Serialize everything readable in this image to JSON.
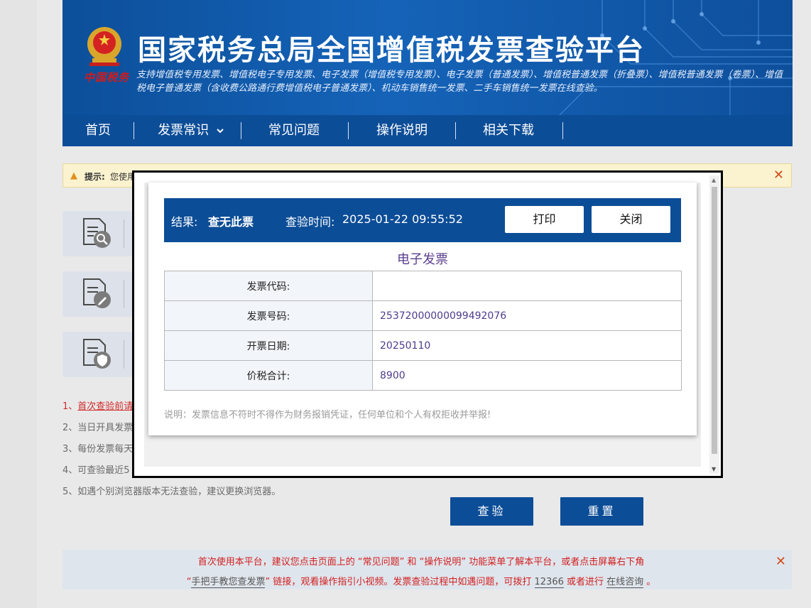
{
  "header": {
    "title": "国家税务总局全国增值税发票查验平台",
    "subtitle": "支持增值税专用发票、增值税电子专用发票、电子发票（增值税专用发票）、电子发票（普通发票）、增值税普通发票（折叠票）、增值税普通发票（卷票）、增值税电子普通发票（含收费公路通行费增值税电子普通发票）、机动车销售统一发票、二手车销售统一发票在线查验。",
    "emblem_text": "中国税务"
  },
  "nav": {
    "items": [
      {
        "label": "首页"
      },
      {
        "label": "发票常识"
      },
      {
        "label": "常见问题"
      },
      {
        "label": "操作说明"
      },
      {
        "label": "相关下载"
      }
    ]
  },
  "tip": {
    "label": "提示:",
    "text": "您使用"
  },
  "notes": {
    "n1_prefix": "1、",
    "n1": "首次查验前请",
    "n2": "2、当日开具发票",
    "n3": "3、每份发票每天",
    "n4": "4、可查验最近5",
    "n5": "5、如遇个别浏览器版本无法查验，建议更换浏览器。"
  },
  "buttons": {
    "check": "查验",
    "reset": "重置"
  },
  "bottom": {
    "line1": "首次使用本平台，建议您点击页面上的 “常见问题” 和 “操作说明” 功能菜单了解本平台，或者点击屏幕右下角",
    "l2_q1": "“",
    "l2_link": "手把手教您查发票",
    "l2_q2": "”",
    "l2_mid": " 链接，观看操作指引小视频。发票查验过程中如遇问题，可拨打 ",
    "l2_phone": "12366",
    "l2_mid2": " 或者进行 ",
    "l2_consult": "在线咨询",
    "l2_end": " 。"
  },
  "modal": {
    "result_label": "结果:",
    "result_value": "查无此票",
    "time_label": "查验时间:",
    "time_value": "2025-01-22 09:55:52",
    "print_label": "打印",
    "close_label": "关闭",
    "invoice_type": "电子发票",
    "rows": [
      {
        "key": "发票代码:",
        "value": ""
      },
      {
        "key": "发票号码:",
        "value": "25372000000099492076"
      },
      {
        "key": "开票日期:",
        "value": "20250110"
      },
      {
        "key": "价税合计:",
        "value": "8900"
      }
    ],
    "note": "说明：发票信息不符时不得作为财务报销凭证，任何单位和个人有权拒收并举报!"
  },
  "colors": {
    "brand_blue": "#0c4d97",
    "alert_red": "#d11f1f",
    "value_purple": "#4e3b8c"
  }
}
